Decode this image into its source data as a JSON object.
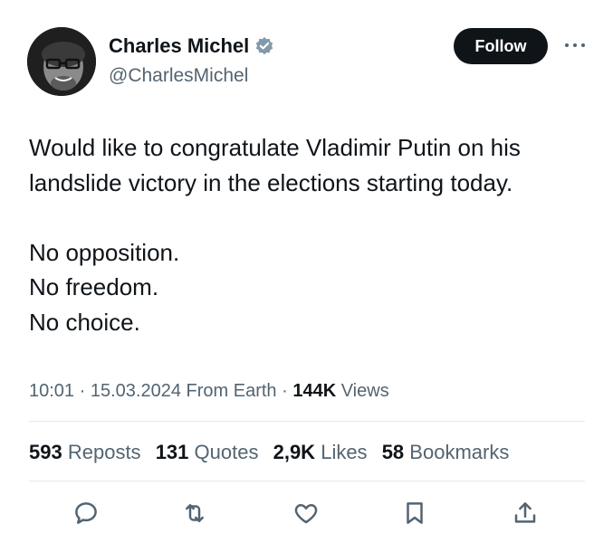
{
  "author": {
    "name": "Charles Michel",
    "handle": "@CharlesMichel",
    "verified_badge_color": "#829aab",
    "follow_label": "Follow"
  },
  "tweet": {
    "lines": [
      "Would like to congratulate Vladimir Putin on his",
      "landslide victory in the elections starting today.",
      "",
      "No opposition.",
      "No freedom.",
      "No choice."
    ]
  },
  "meta": {
    "time": "10:01",
    "date": "15.03.2024",
    "location": "From Earth",
    "views_count": "144K",
    "views_label": "Views"
  },
  "stats": {
    "reposts_count": "593",
    "reposts_label": "Reposts",
    "quotes_count": "131",
    "quotes_label": "Quotes",
    "likes_count": "2,9K",
    "likes_label": "Likes",
    "bookmarks_count": "58",
    "bookmarks_label": "Bookmarks"
  },
  "actions": [
    "reply-icon",
    "repost-icon",
    "like-icon",
    "bookmark-icon",
    "share-icon"
  ],
  "colors": {
    "text": "#0f1419",
    "secondary": "#536471",
    "divider": "#e6e9eb",
    "button": "#0f1419"
  }
}
